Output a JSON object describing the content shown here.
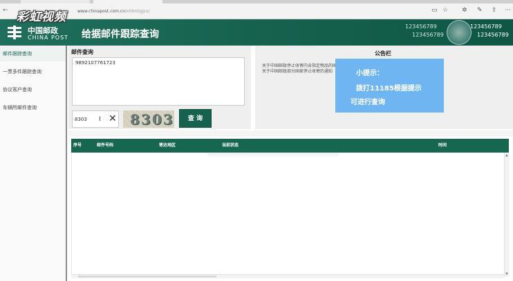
{
  "browser": {
    "url_host": "www.chinapost.com.cn",
    "url_path": "/xhtml/gjcx/",
    "nav_back": "←"
  },
  "watermark": "彩虹视频",
  "header": {
    "logo_cn": "中国邮政",
    "logo_en": "CHINA POST",
    "title": "给据邮件跟踪查询",
    "number_text": "123456789"
  },
  "sidebar": {
    "items": [
      {
        "label": "邮件跟踪查询",
        "active": true
      },
      {
        "label": "一票多件跟踪查询",
        "active": false
      },
      {
        "label": "协议客户查询",
        "active": false
      },
      {
        "label": "车辆所邮件查询",
        "active": false
      }
    ]
  },
  "query": {
    "title": "邮件查询",
    "tracking_number": "9892107761723",
    "captcha_value": "8303",
    "captcha_image_text": "8303",
    "submit_label": "查 询"
  },
  "notice": {
    "title": "公告栏",
    "lines": [
      "关于中国邮政停止收寄内含指定物品的国际邮件的通知",
      "关于中国邮政部分国家停止收寄的通知"
    ]
  },
  "tip": {
    "title": "小提示：",
    "line1": "拨打11185根据提示",
    "line2": "可进行查询"
  },
  "table": {
    "columns": [
      "序号",
      "邮件号码",
      "寄达地区",
      "当前状态",
      "时间"
    ],
    "rows": []
  },
  "colors": {
    "brand_green": "#16624f",
    "tip_blue": "#6fb5f2"
  }
}
